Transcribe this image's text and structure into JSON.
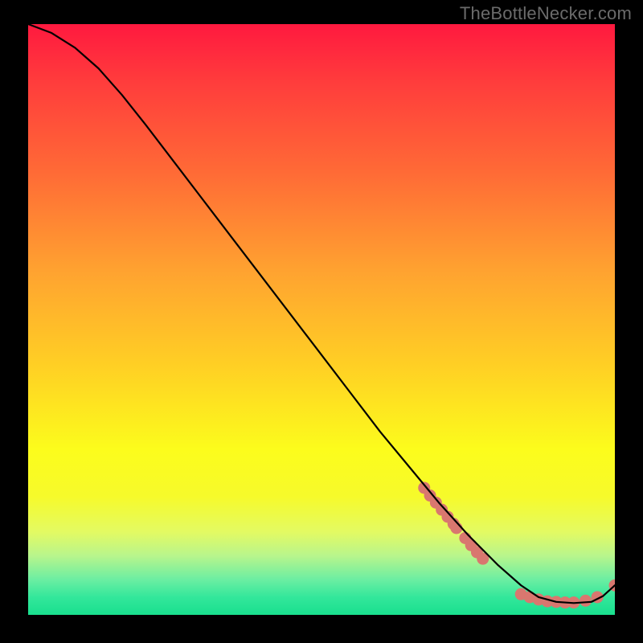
{
  "watermark": "TheBottleNecker.com",
  "chart_data": {
    "type": "line",
    "title": "",
    "xlabel": "",
    "ylabel": "",
    "xlim": [
      0,
      100
    ],
    "ylim": [
      0,
      100
    ],
    "grid": false,
    "legend": false,
    "note": "Axes are unlabeled in the source image; coordinates are normalized 0–100. The curve descends with gentle curvature at the top-left, becomes roughly linear, reaches a minimum plateau near x≈88, then kicks up slightly at the far right.",
    "series": [
      {
        "name": "curve",
        "x": [
          0,
          4,
          8,
          12,
          16,
          20,
          25,
          30,
          35,
          40,
          45,
          50,
          55,
          60,
          65,
          70,
          75,
          80,
          84,
          87,
          90,
          93,
          96,
          98,
          100
        ],
        "y": [
          100,
          98.5,
          96,
          92.5,
          88,
          83,
          76.5,
          70,
          63.5,
          57,
          50.5,
          44,
          37.5,
          31,
          25,
          19,
          13.5,
          8.5,
          5,
          3,
          2.2,
          2.0,
          2.2,
          3.2,
          5
        ],
        "color": "#000000",
        "stroke_width": 2.2
      }
    ],
    "markers": {
      "name": "dots",
      "color": "#d9776f",
      "radius": 7.5,
      "note": "Two clusters: one along the descending segment around x 68–78, one along the plateau around x 84–98.",
      "points": [
        {
          "x": 67.5,
          "y": 21.5
        },
        {
          "x": 68.5,
          "y": 20.2
        },
        {
          "x": 69.5,
          "y": 19.0
        },
        {
          "x": 70.5,
          "y": 17.8
        },
        {
          "x": 71.5,
          "y": 16.6
        },
        {
          "x": 72.5,
          "y": 15.4
        },
        {
          "x": 73.0,
          "y": 14.7
        },
        {
          "x": 74.5,
          "y": 13.0
        },
        {
          "x": 75.5,
          "y": 11.8
        },
        {
          "x": 76.5,
          "y": 10.6
        },
        {
          "x": 77.5,
          "y": 9.5
        },
        {
          "x": 84.0,
          "y": 3.5
        },
        {
          "x": 85.5,
          "y": 3.0
        },
        {
          "x": 87.0,
          "y": 2.6
        },
        {
          "x": 88.5,
          "y": 2.3
        },
        {
          "x": 90.0,
          "y": 2.2
        },
        {
          "x": 91.5,
          "y": 2.1
        },
        {
          "x": 93.0,
          "y": 2.1
        },
        {
          "x": 95.0,
          "y": 2.4
        },
        {
          "x": 97.0,
          "y": 3.0
        },
        {
          "x": 100.0,
          "y": 5.0
        }
      ]
    }
  }
}
